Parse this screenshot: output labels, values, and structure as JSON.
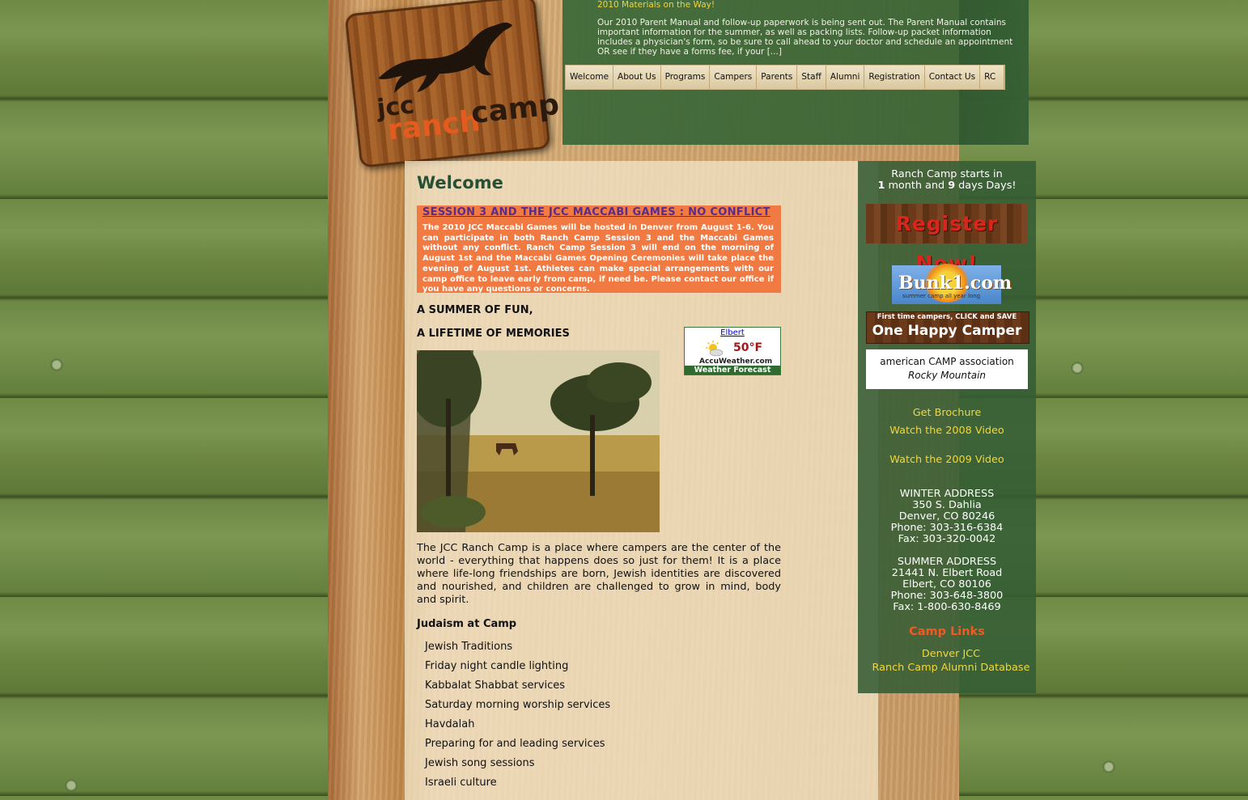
{
  "brand": {
    "line1": "jcc",
    "line2_a": "ranch",
    "line2_b": "camp"
  },
  "news": {
    "title": "2010 Materials on the Way!",
    "text": "Our 2010 Parent Manual and follow-up paperwork is being sent out. The Parent Manual contains important information for the summer, as well as packing lists. Follow-up packet information includes a physician's form, so be sure to call ahead to your doctor and schedule an appointment OR see if they have a forms fee, if your [...]"
  },
  "nav": {
    "items": [
      {
        "label": "Welcome"
      },
      {
        "label": "About Us"
      },
      {
        "label": "Programs"
      },
      {
        "label": "Campers"
      },
      {
        "label": "Parents"
      },
      {
        "label": "Staff"
      },
      {
        "label": "Alumni"
      },
      {
        "label": "Registration"
      },
      {
        "label": "Contact Us"
      },
      {
        "label": "RC"
      }
    ]
  },
  "main": {
    "title": "Welcome",
    "notice": {
      "title": "SESSION 3 AND THE JCC MACCABI GAMES : NO CONFLICT",
      "text": "The 2010 JCC Maccabi Games will be hosted in Denver from August 1-6. You can participate in both Ranch Camp Session 3 and the Maccabi Games without any conflict. Ranch Camp Session 3 will end on the morning of August 1st and the Maccabi Games Opening Ceremonies will take place the evening of August 1st. Athletes can make special arrangements with our camp office to leave early from camp, if need be. Please contact our office if you have any questions or concerns."
    },
    "heading1": "A SUMMER OF FUN,",
    "heading2": "A LIFETIME OF MEMORIES",
    "intro": "The JCC Ranch Camp is a place where campers are the center of the world - everything that happens does so just for them! It is a place where life-long friendships are born, Jewish identities are discovered and nourished, and children are challenged to grow in mind, body and spirit.",
    "judaism_heading": "Judaism at Camp",
    "judaism_items": [
      "Jewish Traditions",
      "Friday night candle lighting",
      "Kabbalat Shabbat services",
      "Saturday morning worship services",
      "Havdalah",
      "Preparing for and leading services",
      "Jewish song sessions",
      "Israeli culture"
    ]
  },
  "weather": {
    "city": "Elbert",
    "temp": "50°F",
    "brand": "AccuWeather.com",
    "footer": "Weather Forecast"
  },
  "sidebar": {
    "countdown_line1": "Ranch Camp starts in",
    "countdown_months": "1",
    "countdown_months_label": " month and ",
    "countdown_days": "9",
    "countdown_days_label": " days Days!",
    "register_label": "Register Now!",
    "bunk_label": "Bunk1.com",
    "bunk_sub": "summer camp all year long",
    "happy_small": "First time campers, CLICK and SAVE",
    "happy_big": "One Happy Camper",
    "aca_top": "american CAMP association",
    "aca_bottom": "Rocky Mountain",
    "links": [
      "Get Brochure",
      "Watch the 2008 Video",
      "Watch the 2009 Video"
    ],
    "winter": [
      "WINTER ADDRESS",
      "350 S. Dahlia",
      "Denver, CO 80246",
      "Phone: 303-316-6384",
      "Fax: 303-320-0042"
    ],
    "summer": [
      "SUMMER ADDRESS",
      "21441 N. Elbert Road",
      "Elbert, CO 80106",
      "Phone: 303-648-3800",
      "Fax: 1-800-630-8469"
    ],
    "camp_links_title": "Camp Links",
    "camp_links": [
      "Denver JCC",
      "Ranch Camp Alumni Database"
    ]
  }
}
